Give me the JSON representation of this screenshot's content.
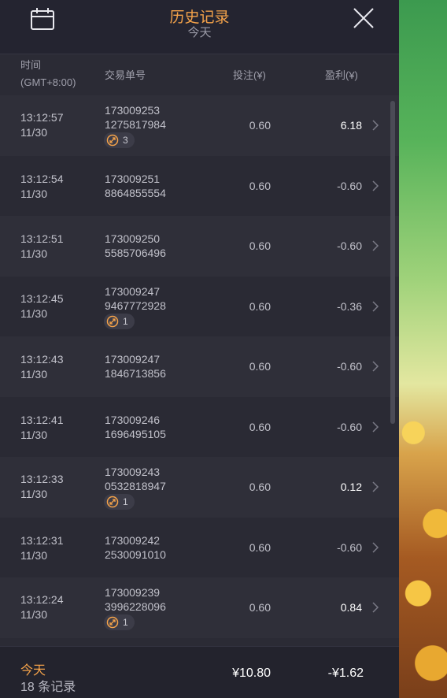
{
  "header": {
    "title": "历史记录",
    "subtitle": "今天"
  },
  "columns": {
    "time": "时间",
    "timezone": "(GMT+8:00)",
    "order_id": "交易单号",
    "bet": "投注(¥)",
    "profit": "盈利(¥)"
  },
  "rows": [
    {
      "time": "13:12:57",
      "date": "11/30",
      "id1": "173009253",
      "id2": "1275817984",
      "bet": "0.60",
      "profit": "6.18",
      "win": true,
      "badge": "3"
    },
    {
      "time": "13:12:54",
      "date": "11/30",
      "id1": "173009251",
      "id2": "8864855554",
      "bet": "0.60",
      "profit": "-0.60",
      "win": false,
      "badge": null
    },
    {
      "time": "13:12:51",
      "date": "11/30",
      "id1": "173009250",
      "id2": "5585706496",
      "bet": "0.60",
      "profit": "-0.60",
      "win": false,
      "badge": null
    },
    {
      "time": "13:12:45",
      "date": "11/30",
      "id1": "173009247",
      "id2": "9467772928",
      "bet": "0.60",
      "profit": "-0.36",
      "win": false,
      "badge": "1"
    },
    {
      "time": "13:12:43",
      "date": "11/30",
      "id1": "173009247",
      "id2": "1846713856",
      "bet": "0.60",
      "profit": "-0.60",
      "win": false,
      "badge": null
    },
    {
      "time": "13:12:41",
      "date": "11/30",
      "id1": "173009246",
      "id2": "1696495105",
      "bet": "0.60",
      "profit": "-0.60",
      "win": false,
      "badge": null
    },
    {
      "time": "13:12:33",
      "date": "11/30",
      "id1": "173009243",
      "id2": "0532818947",
      "bet": "0.60",
      "profit": "0.12",
      "win": true,
      "badge": "1"
    },
    {
      "time": "13:12:31",
      "date": "11/30",
      "id1": "173009242",
      "id2": "2530091010",
      "bet": "0.60",
      "profit": "-0.60",
      "win": false,
      "badge": null
    },
    {
      "time": "13:12:24",
      "date": "11/30",
      "id1": "173009239",
      "id2": "3996228096",
      "bet": "0.60",
      "profit": "0.84",
      "win": true,
      "badge": "1"
    }
  ],
  "footer": {
    "label": "今天",
    "count": "18 条记录",
    "total_bet": "¥10.80",
    "total_profit": "-¥1.62"
  },
  "colors": {
    "accent": "#f5a34a",
    "text": "#c2c2cb",
    "win": "#ffffff"
  },
  "icons": {
    "calendar": "calendar-icon",
    "close": "close-icon",
    "row_chevron": "chevron-right-icon",
    "badge": "free-spin-icon"
  }
}
